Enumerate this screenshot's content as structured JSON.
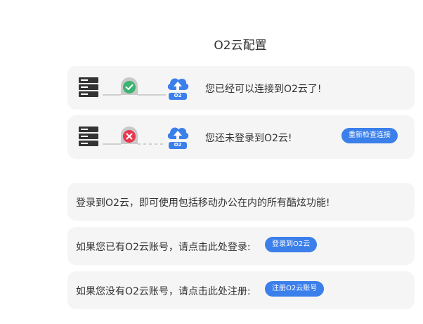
{
  "page": {
    "title": "O2云配置"
  },
  "status_connected": {
    "message": "您已经可以连接到O2云了!",
    "cloud_label": "O2"
  },
  "status_not_logged_in": {
    "message": "您还未登录到O2云!",
    "cloud_label": "O2",
    "recheck_button": "重新检查连接"
  },
  "info": {
    "text": "登录到O2云，即可使用包括移动办公在内的所有酷炫功能!"
  },
  "login_row": {
    "text": "如果您已有O2云账号，请点击此处登录:",
    "button": "登录到O2云"
  },
  "register_row": {
    "text": "如果您没有O2云账号，请点击此处注册:",
    "button": "注册O2云账号"
  },
  "colors": {
    "accent": "#3b7fea",
    "success": "#3cb371",
    "error": "#e8384f",
    "card_bg": "#f5f5f5",
    "server": "#333333"
  }
}
